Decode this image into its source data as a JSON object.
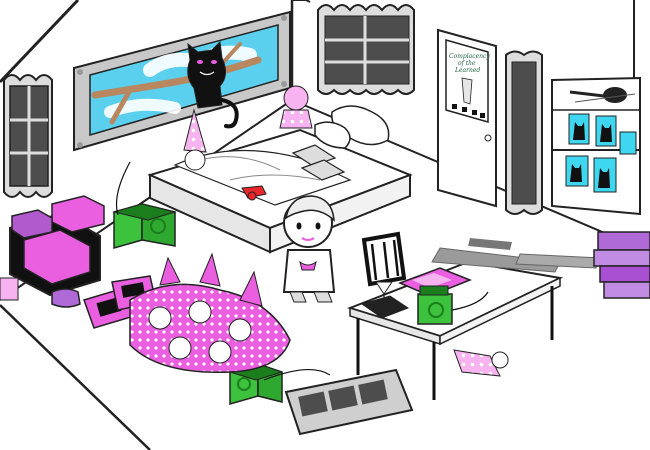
{
  "scene": {
    "poster": {
      "line1": "Complacency",
      "line2": "of the",
      "line3": "Learned"
    },
    "colors": {
      "outline": "#222222",
      "wall_gray": "#d9d9d9",
      "window_gray": "#4d4d4d",
      "pink": "#e95fe0",
      "light_pink": "#f7b3f0",
      "green": "#3cc23c",
      "dark_green": "#1c7d1c",
      "cyan": "#3fd6ef",
      "sky": "#5bd0ee",
      "branch": "#b8865f",
      "black": "#111111",
      "lipstick_red": "#e8272a"
    },
    "icons": {
      "cat": "black-cat-icon",
      "plush": "pink-wizard-plush-icon",
      "lipstick": "lipstick-icon",
      "needles": "knitting-needles-icon"
    }
  }
}
